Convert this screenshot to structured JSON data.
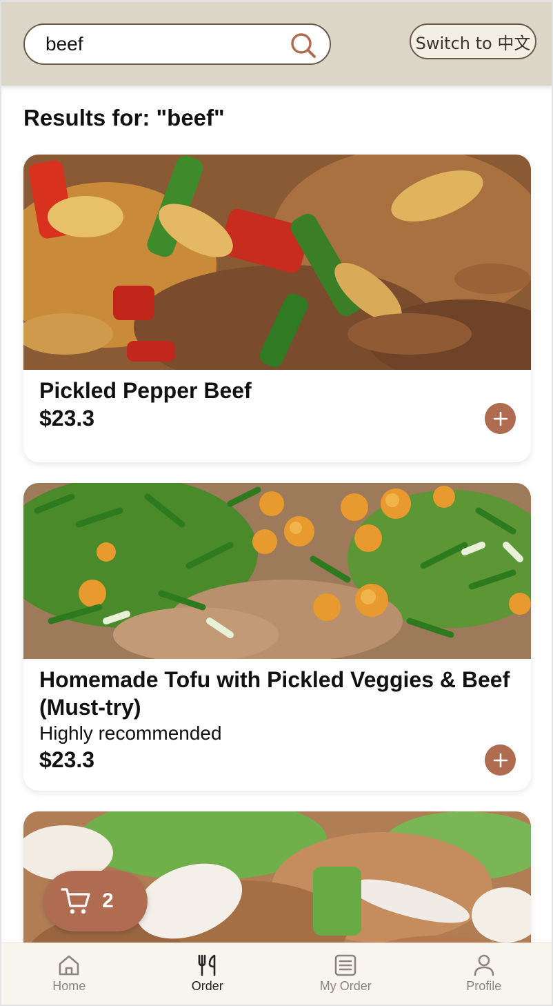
{
  "header": {
    "search": {
      "value": "beef",
      "placeholder": ""
    },
    "lang_button": "Switch to 中文"
  },
  "results": {
    "title": "Results for: \"beef\""
  },
  "dishes": [
    {
      "name": "Pickled Pepper Beef",
      "description": "",
      "price": "$23.3"
    },
    {
      "name": "Homemade Tofu with Pickled Veggies & Beef (Must-try)",
      "description": "Highly recommended",
      "price": "$23.3"
    },
    {
      "name": "",
      "description": "",
      "price": ""
    }
  ],
  "cart": {
    "count": "2",
    "icon": "cart-icon"
  },
  "nav": {
    "items": [
      {
        "label": "Home",
        "icon": "home-icon",
        "active": false
      },
      {
        "label": "Order",
        "icon": "utensils-icon",
        "active": true
      },
      {
        "label": "My Order",
        "icon": "list-icon",
        "active": false
      },
      {
        "label": "Profile",
        "icon": "user-icon",
        "active": false
      }
    ]
  },
  "colors": {
    "header_bg": "#dcd6c8",
    "accent": "#b06c50",
    "nav_bg": "#f8f5ef",
    "border": "#6b5a4a"
  }
}
